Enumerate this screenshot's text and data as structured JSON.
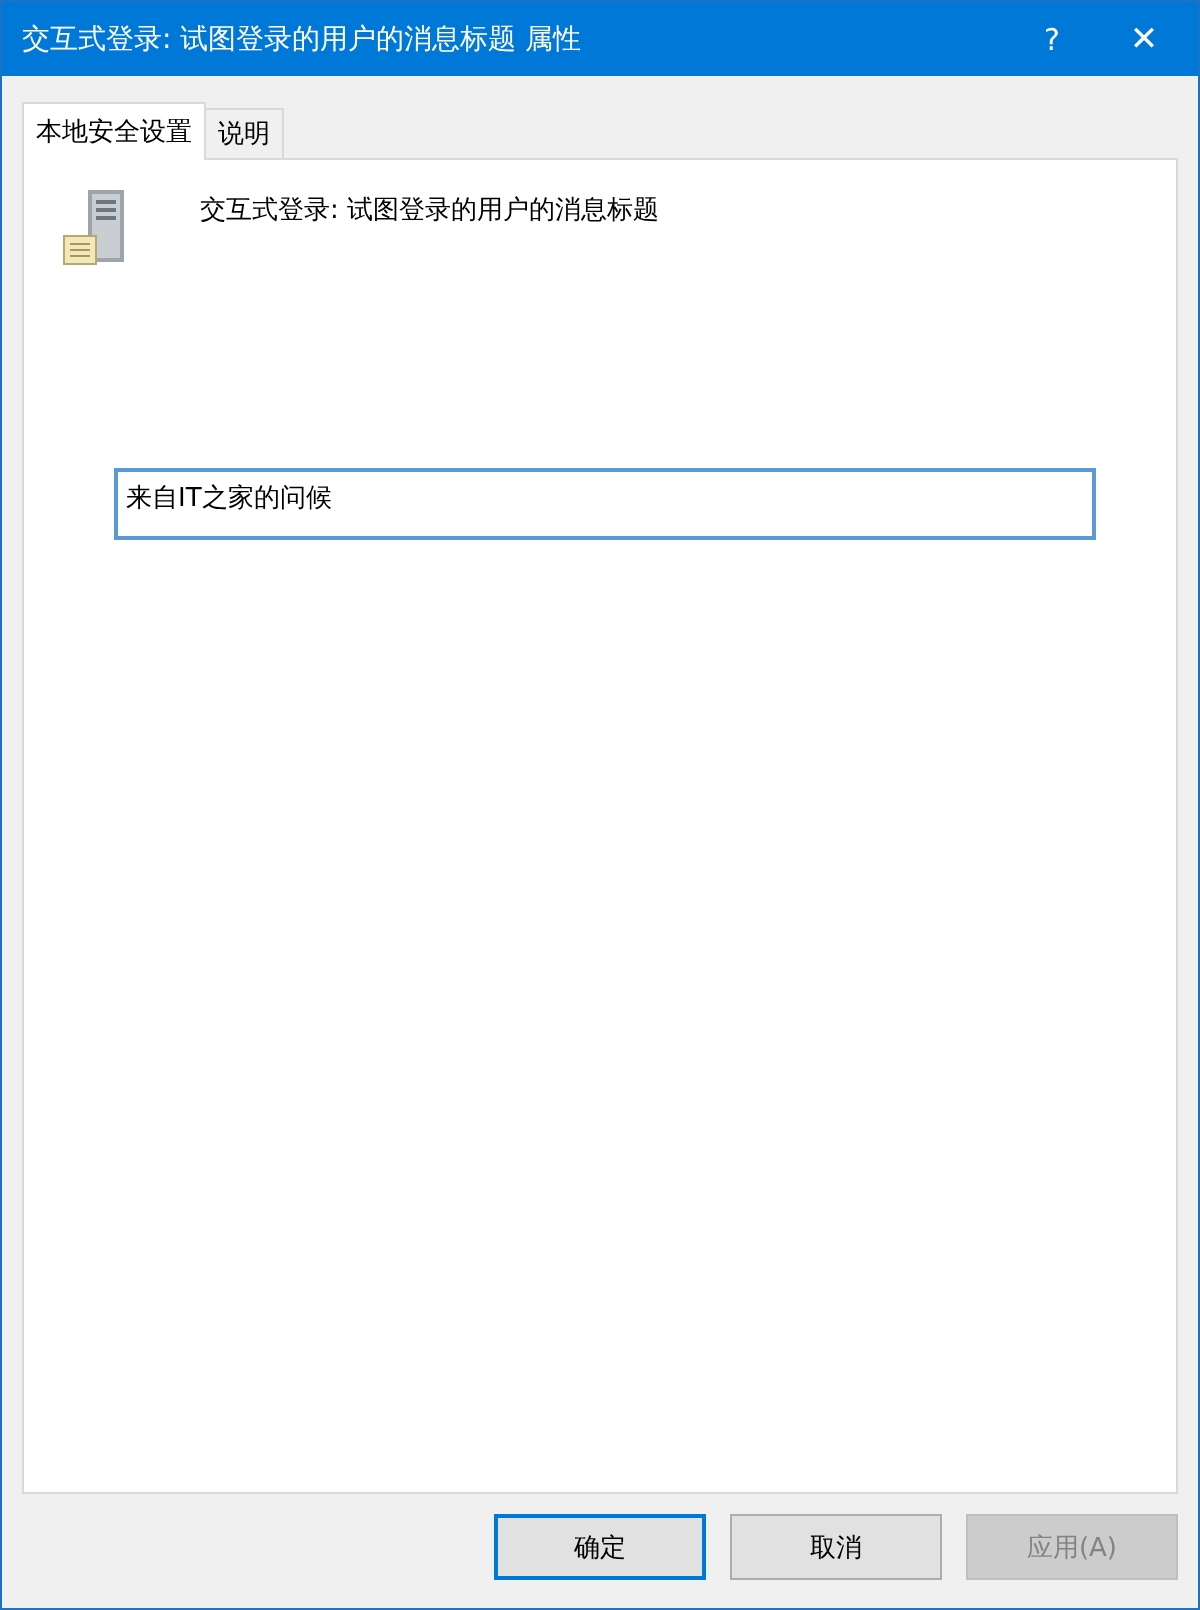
{
  "window": {
    "title": "交互式登录: 试图登录的用户的消息标题 属性",
    "help": "?",
    "close": "✕"
  },
  "tabs": [
    {
      "label": "本地安全设置",
      "selected": true
    },
    {
      "label": "说明",
      "selected": false
    }
  ],
  "policy": {
    "name": "交互式登录: 试图登录的用户的消息标题"
  },
  "text_field": {
    "value": "来自IT之家的问候",
    "focused": true
  },
  "buttons": [
    {
      "label": "确定",
      "kind": "default",
      "disabled": false
    },
    {
      "label": "取消",
      "kind": "normal",
      "disabled": false
    },
    {
      "label": "应用(A)",
      "kind": "normal",
      "disabled": true
    }
  ]
}
